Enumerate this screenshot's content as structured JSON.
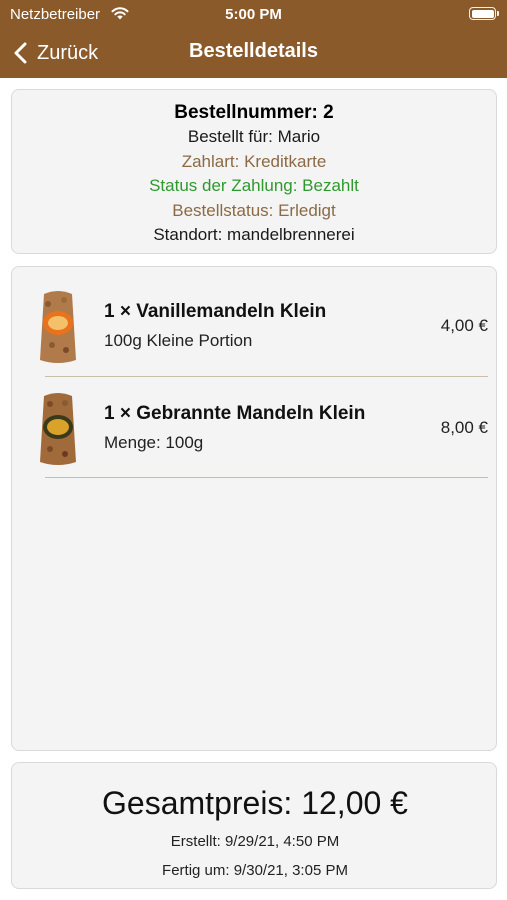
{
  "status_bar": {
    "carrier": "Netzbetreiber",
    "time": "5:00 PM"
  },
  "nav": {
    "back_label": "Zurück",
    "title": "Bestelldetails",
    "background_color": "#8b5a2b"
  },
  "order_info": {
    "order_number": "Bestellnummer: 2",
    "ordered_for": "Bestellt für: Mario",
    "payment_method": "Zahlart: Kreditkarte",
    "payment_status": "Status der Zahlung: Bezahlt",
    "order_status": "Bestellstatus: Erledigt",
    "location": "Standort: mandelbrennerei"
  },
  "items": [
    {
      "name": "1 × Vanillemandeln Klein",
      "description": "100g Kleine Portion",
      "price": "4,00 €",
      "icon": "almond-bag-orange-image"
    },
    {
      "name": "1 × Gebrannte Mandeln Klein",
      "description": "Menge: 100g",
      "price": "8,00 €",
      "icon": "almond-bag-gold-image"
    }
  ],
  "summary": {
    "total": "Gesamtpreis: 12,00 €",
    "created": "Erstellt: 9/29/21, 4:50 PM",
    "finished": "Fertig um: 9/30/21, 3:05 PM"
  },
  "colors": {
    "accent_brown": "#8b5a2b",
    "text_brown": "#8b6a45",
    "status_green": "#2e9a2e"
  }
}
